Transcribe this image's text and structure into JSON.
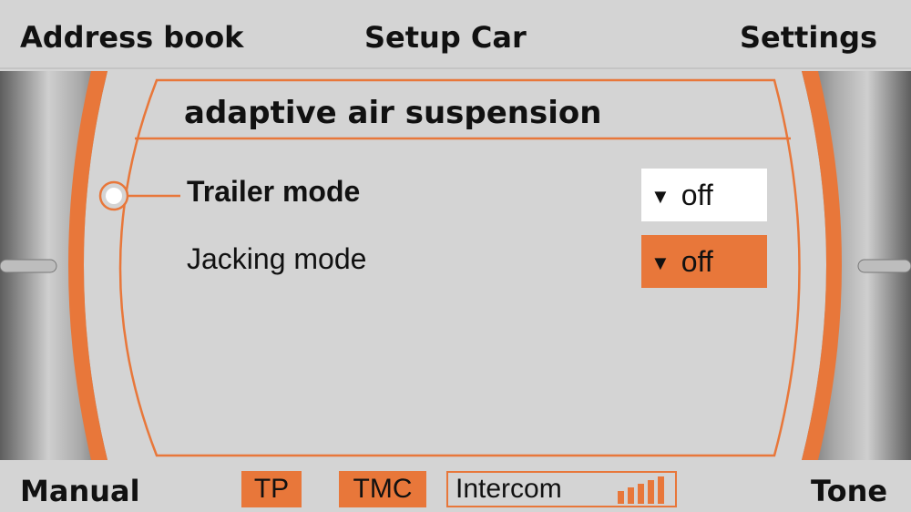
{
  "softkeys": {
    "top_left": "Address book",
    "top_center": "Setup Car",
    "top_right": "Settings",
    "bottom_left": "Manual",
    "bottom_right": "Tone"
  },
  "panel": {
    "title": "adaptive air suspension",
    "rows": [
      {
        "label": "Trailer mode",
        "value": "off",
        "selected": true
      },
      {
        "label": "Jacking mode",
        "value": "off",
        "highlighted": true
      }
    ]
  },
  "status_bar": {
    "tp": "TP",
    "tmc": "TMC",
    "intercom": "Intercom",
    "signal_bars": 5
  },
  "colors": {
    "accent": "#e8773a",
    "background": "#d4d4d4"
  }
}
